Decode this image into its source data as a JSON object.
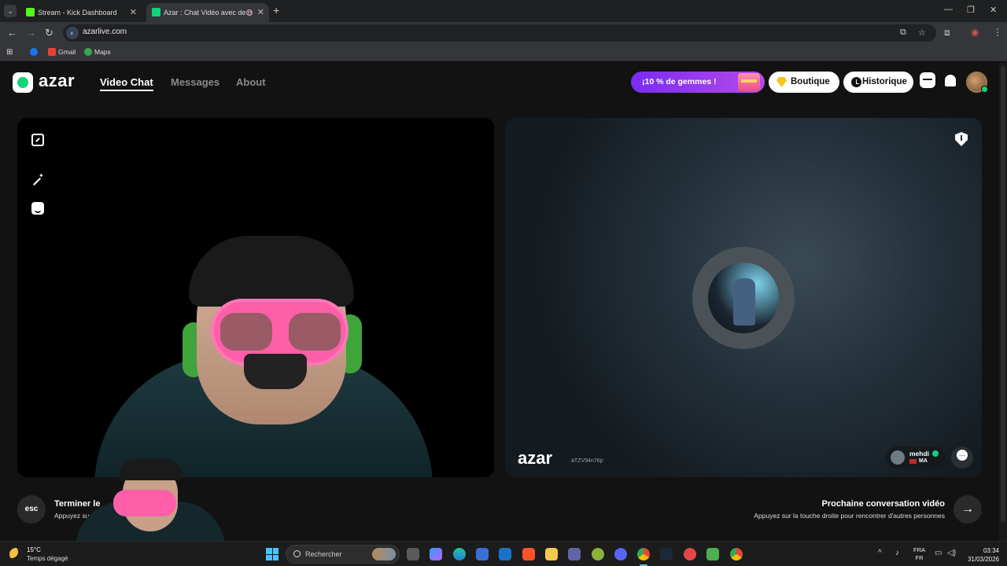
{
  "browser": {
    "tabs": [
      {
        "title": "Stream - Kick Dashboard",
        "color": "#53fc18"
      },
      {
        "title": "Azar : Chat Vidéo avec de n",
        "color": "#10d47a"
      }
    ],
    "url": "azarlive.com",
    "bookmarks": [
      {
        "label": "",
        "icon": "facebook-icon"
      },
      {
        "label": "Gmail",
        "icon": "gmail-icon"
      },
      {
        "label": "Maps",
        "icon": "maps-icon"
      }
    ]
  },
  "azar": {
    "logo_text": "azar",
    "nav": [
      "Video Chat",
      "Messages",
      "About"
    ],
    "promo": "¡10 % de gemmes !",
    "shop": "Boutique",
    "history": "Historique",
    "remote": {
      "brand": "azar",
      "id": "aTZV94n76p",
      "user_name": "mehdi",
      "country": "MA"
    },
    "end": {
      "key": "esc",
      "title": "Terminer le",
      "subtitle": "Appuyez su            uc               e fin au chat vidéo."
    },
    "next": {
      "title": "Prochaine conversation vidéo",
      "subtitle": "Appuyez sur la touche droite pour rencontrer d'autres personnes",
      "arrow": "→"
    }
  },
  "taskbar": {
    "temp": "15°C",
    "weather": "Temps dégagé",
    "search_placeholder": "Rechercher",
    "lang1": "FRA",
    "lang2": "FR",
    "time": "03:34",
    "date": "31/03/2026"
  }
}
